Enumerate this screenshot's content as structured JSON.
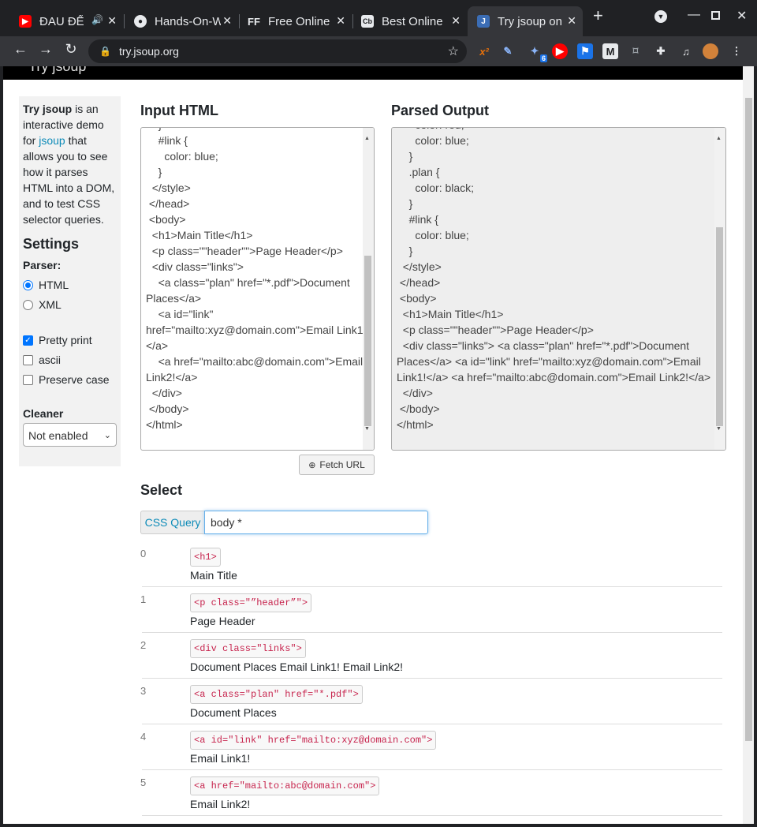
{
  "browser": {
    "tabs": [
      {
        "title": "ĐAU ĐỂ",
        "icon": "youtube-icon"
      },
      {
        "title": "Hands-On-W",
        "icon": "github-icon"
      },
      {
        "title": "Free Online",
        "icon": "ff-icon"
      },
      {
        "title": "Best Online",
        "icon": "cb-icon"
      },
      {
        "title": "Try jsoup on",
        "icon": "jsoup-icon"
      }
    ],
    "url": "try.jsoup.org",
    "ext_badge": "6"
  },
  "page": {
    "brand": "Try jsoup",
    "sidebar": {
      "intro_bold": "Try jsoup",
      "intro_1": " is an interactive demo for ",
      "intro_link": "jsoup",
      "intro_2": " that allows you to see how it parses HTML into a DOM, and to test CSS selector queries.",
      "settings_title": "Settings",
      "parser_label": "Parser:",
      "parser_options": [
        "HTML",
        "XML"
      ],
      "checks": [
        "Pretty print",
        "ascii",
        "Preserve case"
      ],
      "cleaner_label": "Cleaner",
      "cleaner_value": "Not enabled"
    },
    "input_title": "Input HTML",
    "output_title": "Parsed Output",
    "input_html": "    }\n    #link {\n      color: blue;\n    }\n  </style>\n </head>\n <body>\n  <h1>Main Title</h1>\n  <p class=\"\"header\"\">Page Header</p>\n  <div class=\"links\">\n    <a class=\"plan\" href=\"*.pdf\">Document Places</a>\n    <a id=\"link\" href=\"mailto:xyz@domain.com\">Email Link1!</a>\n    <a href=\"mailto:abc@domain.com\">Email Link2!</a>\n  </div>\n </body>\n</html>",
    "output_html": "      color: red;\n      color: blue;\n    }\n    .plan {\n      color: black;\n    }\n    #link {\n      color: blue;\n    }\n  </style>\n </head>\n <body>\n  <h1>Main Title</h1>\n  <p class=\"\"header\"\">Page Header</p>\n  <div class=\"links\"> <a class=\"plan\" href=\"*.pdf\">Document Places</a> <a id=\"link\" href=\"mailto:xyz@domain.com\">Email Link1!</a> <a href=\"mailto:abc@domain.com\">Email Link2!</a>\n  </div>\n </body>\n</html>",
    "fetch_label": "Fetch URL",
    "select_title": "Select",
    "query_label": "CSS Query",
    "query_value": "body *",
    "results": [
      {
        "idx": "0",
        "tag": "<h1>",
        "text": "Main Title"
      },
      {
        "idx": "1",
        "tag": "<p class=\"”header”\">",
        "text": "Page Header"
      },
      {
        "idx": "2",
        "tag": "<div class=\"links\">",
        "text": "Document Places Email Link1! Email Link2!"
      },
      {
        "idx": "3",
        "tag": "<a class=\"plan\" href=\"*.pdf\">",
        "text": "Document Places"
      },
      {
        "idx": "4",
        "tag": "<a id=\"link\" href=\"mailto:xyz@domain.com\">",
        "text": "Email Link1!"
      },
      {
        "idx": "5",
        "tag": "<a href=\"mailto:abc@domain.com\">",
        "text": "Email Link2!"
      }
    ]
  }
}
